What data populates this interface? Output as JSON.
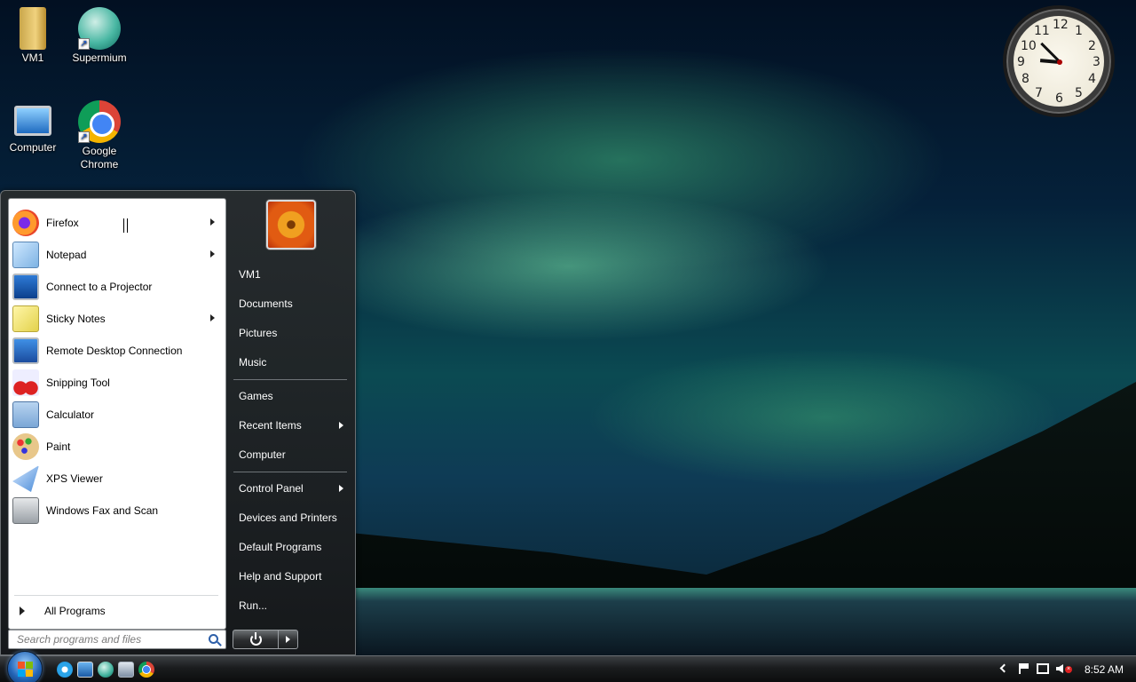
{
  "desktop": {
    "icons": [
      {
        "label": "VM1",
        "icon": "folder-icon"
      },
      {
        "label": "Supermium",
        "icon": "supermium-icon"
      },
      {
        "label": "Computer",
        "icon": "computer-icon"
      },
      {
        "label": "Google Chrome",
        "icon": "chrome-icon"
      }
    ]
  },
  "clock": {
    "numbers": [
      "12",
      "1",
      "2",
      "3",
      "4",
      "5",
      "6",
      "7",
      "8",
      "9",
      "10",
      "11"
    ]
  },
  "start_menu": {
    "programs": [
      {
        "label": "Firefox",
        "icon": "firefox-icon",
        "submenu": true
      },
      {
        "label": "Notepad",
        "icon": "notepad-icon",
        "submenu": true
      },
      {
        "label": "Connect to a Projector",
        "icon": "projector-icon",
        "submenu": false
      },
      {
        "label": "Sticky Notes",
        "icon": "sticky-notes-icon",
        "submenu": true
      },
      {
        "label": "Remote Desktop Connection",
        "icon": "remote-desktop-icon",
        "submenu": false
      },
      {
        "label": "Snipping Tool",
        "icon": "snipping-tool-icon",
        "submenu": false
      },
      {
        "label": "Calculator",
        "icon": "calculator-icon",
        "submenu": false
      },
      {
        "label": "Paint",
        "icon": "paint-icon",
        "submenu": false
      },
      {
        "label": "XPS Viewer",
        "icon": "xps-viewer-icon",
        "submenu": false
      },
      {
        "label": "Windows Fax and Scan",
        "icon": "fax-scan-icon",
        "submenu": false
      }
    ],
    "all_programs": "All Programs",
    "search_placeholder": "Search programs and files",
    "right_items": [
      {
        "label": "VM1",
        "submenu": false
      },
      {
        "label": "Documents",
        "submenu": false
      },
      {
        "label": "Pictures",
        "submenu": false
      },
      {
        "label": "Music",
        "submenu": false
      },
      {
        "label": "Games",
        "submenu": false
      },
      {
        "label": "Recent Items",
        "submenu": true
      },
      {
        "label": "Computer",
        "submenu": false
      },
      {
        "label": "Control Panel",
        "submenu": true
      },
      {
        "label": "Devices and Printers",
        "submenu": false
      },
      {
        "label": "Default Programs",
        "submenu": false
      },
      {
        "label": "Help and Support",
        "submenu": false
      },
      {
        "label": "Run...",
        "submenu": false
      }
    ]
  },
  "taskbar": {
    "quick_launch": [
      "internet-explorer-icon",
      "show-desktop-icon",
      "supermium-icon",
      "explorer-icon",
      "chrome-icon"
    ],
    "time": "8:52 AM"
  },
  "colors": {
    "taskbar": "#1a1c1e",
    "start_menu": "#2a2d2f",
    "accent": "#2466b8"
  }
}
